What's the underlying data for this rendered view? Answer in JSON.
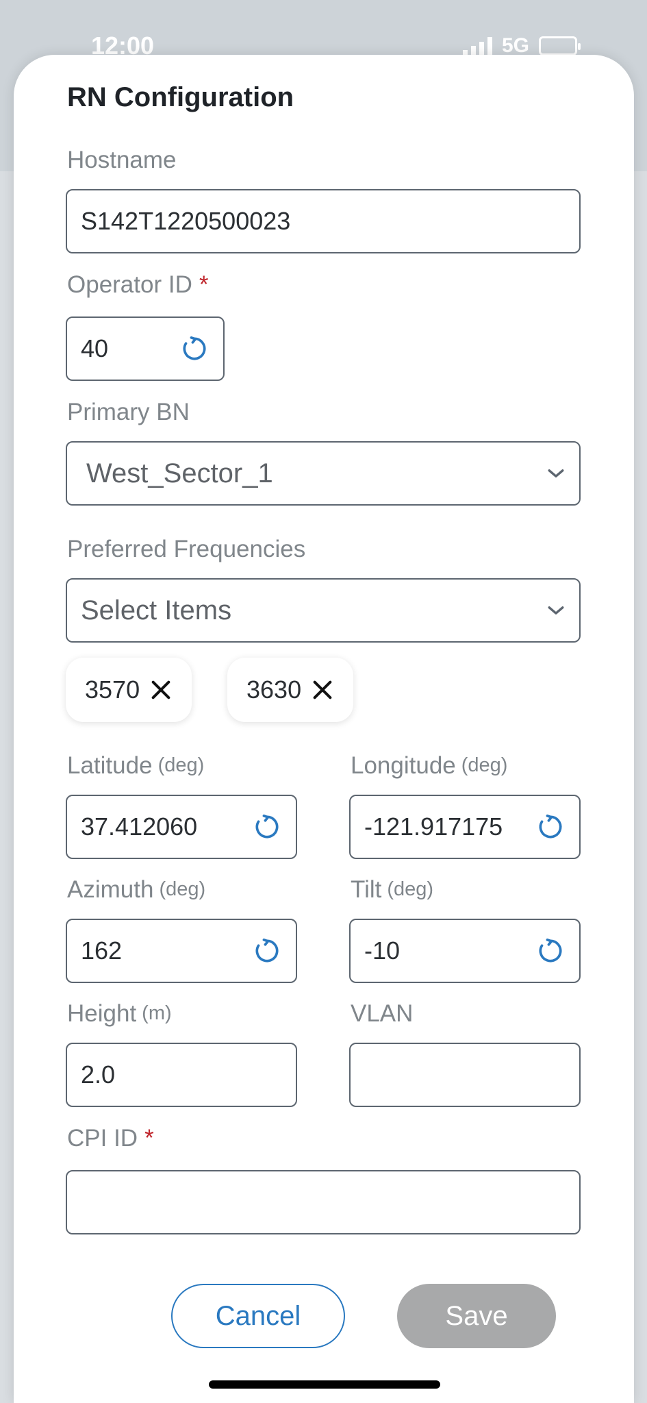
{
  "status": {
    "time": "12:00",
    "network": "5G"
  },
  "form": {
    "title": "RN Configuration",
    "hostname": {
      "label": "Hostname",
      "value": "S142T1220500023"
    },
    "operator_id": {
      "label": "Operator ID",
      "required_mark": "*",
      "value": "40"
    },
    "primary_bn": {
      "label": "Primary BN",
      "value": "West_Sector_1"
    },
    "preferred_frequencies": {
      "label": "Preferred Frequencies",
      "placeholder": "Select Items",
      "chips": [
        "3570",
        "3630"
      ]
    },
    "latitude": {
      "label": "Latitude",
      "unit": "(deg)",
      "value": "37.412060"
    },
    "longitude": {
      "label": "Longitude",
      "unit": "(deg)",
      "value": "-121.917175"
    },
    "azimuth": {
      "label": "Azimuth",
      "unit": "(deg)",
      "value": "162"
    },
    "tilt": {
      "label": "Tilt",
      "unit": "(deg)",
      "value": "-10"
    },
    "height": {
      "label": "Height",
      "unit": "(m)",
      "value": "2.0"
    },
    "vlan": {
      "label": "VLAN",
      "value": ""
    },
    "cpi_id": {
      "label": "CPI ID",
      "required_mark": "*",
      "value": ""
    }
  },
  "actions": {
    "cancel_label": "Cancel",
    "save_label": "Save"
  },
  "icons": {
    "refresh": "refresh-icon",
    "chevron": "chevron-down-icon",
    "remove": "close-icon"
  },
  "colors": {
    "accent": "#2a79c0",
    "required": "#c0272d",
    "disabled_button": "#a8a9aa"
  }
}
